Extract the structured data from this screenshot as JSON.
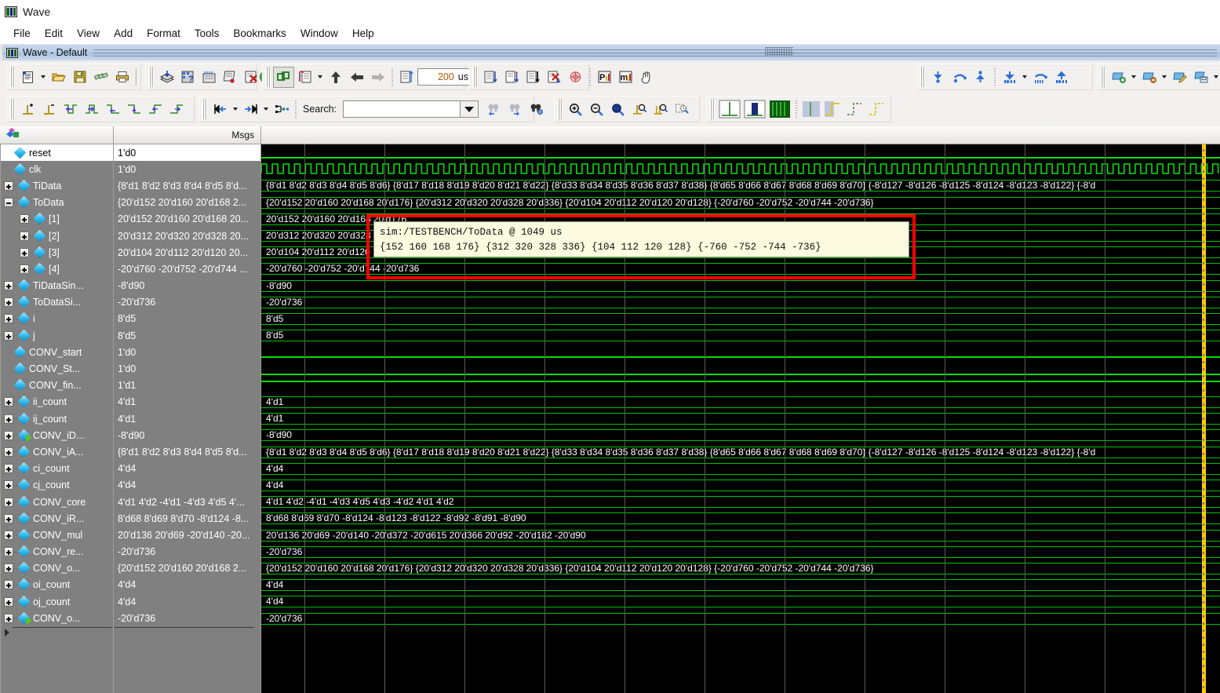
{
  "window": {
    "title": "Wave",
    "icon": "wave-window-icon"
  },
  "menubar": {
    "items": [
      "File",
      "Edit",
      "View",
      "Add",
      "Format",
      "Tools",
      "Bookmarks",
      "Window",
      "Help"
    ]
  },
  "doctab": {
    "label": "Wave - Default",
    "icon": "wave-doc-icon"
  },
  "toolbar": {
    "run_length_value": "200",
    "run_length_unit": "us",
    "search_label": "Search:",
    "search_value": "",
    "row1_icons": [
      "new-document-icon",
      "open-folder-icon",
      "save-icon",
      "reload-icon",
      "print-icon",
      "cut-icon",
      "copy-icon",
      "paste-icon",
      "undo-icon",
      "redo-icon",
      "add-wave-icon",
      "find-icon",
      "properties-icon",
      "compile-icon",
      "simulate-icon",
      "restart-icon",
      "run-icon",
      "stop-icon",
      "group-icon",
      "insert-breakpoint-icon",
      "step-up-icon",
      "step-back-icon",
      "step-forward-icon",
      "run-all-icon",
      "run-length-field",
      "step-icon",
      "step-over-icon",
      "step-out-icon",
      "break-icon",
      "restart-sim-icon",
      "profile-perf-icon",
      "profile-mem-icon",
      "hand-pan-icon",
      "insert-cursor-icon",
      "next-transition-icon",
      "prev-transition-icon",
      "cursor-down-icon",
      "cursor-round-icon",
      "cursor-up-icon",
      "wave-add-icon",
      "wave-remove-icon",
      "wave-edit-icon",
      "wave-save-icon",
      "wave-export-icon"
    ],
    "row2_icons": [
      "add-cursor-icon",
      "delete-cursor-icon",
      "find-prev-transition-icon",
      "find-next-transition-icon",
      "find-prev-falling-icon",
      "find-next-falling-icon",
      "find-prev-rising-icon",
      "find-next-rising-icon",
      "expand-left-icon",
      "collapse-icon",
      "expand-all-icon",
      "search-prev-icon",
      "search-next-icon",
      "search-config-icon",
      "zoom-in-icon",
      "zoom-out-icon",
      "zoom-full-icon",
      "zoom-cursor-icon",
      "zoom-range-icon",
      "zoom-mouse-icon",
      "grid-line-icon",
      "grid-bar-icon",
      "grid-solid-icon",
      "analog-step-icon",
      "analog-interpolated-icon",
      "analog-back-icon",
      "analog-forward-icon"
    ]
  },
  "panes": {
    "names_header_icon": "objects-icon",
    "values_header": "Msgs"
  },
  "signals": [
    {
      "name": "reset",
      "value": "1'd0",
      "indent": 0,
      "expand": "none",
      "selected": true,
      "wave": "low",
      "icon": "signal-diamond"
    },
    {
      "name": "clk",
      "value": "1'd0",
      "indent": 0,
      "expand": "none",
      "selected": false,
      "wave": "clock",
      "icon": "signal-diamond"
    },
    {
      "name": "TiData",
      "value": "{8'd1 8'd2 8'd3 8'd4 8'd5 8'd...",
      "indent": 0,
      "expand": "plus",
      "selected": false,
      "wave": "bus",
      "icon": "signal-diamond",
      "wave_text": "{8'd1 8'd2 8'd3 8'd4 8'd5 8'd6} {8'd17 8'd18 8'd19 8'd20 8'd21 8'd22} {8'd33 8'd34 8'd35 8'd36 8'd37 8'd38} {8'd65 8'd66 8'd67 8'd68 8'd69 8'd70} {-8'd127 -8'd126 -8'd125 -8'd124 -8'd123 -8'd122} {-8'd"
    },
    {
      "name": "ToData",
      "value": "{20'd152 20'd160 20'd168 2...",
      "indent": 0,
      "expand": "minus",
      "selected": false,
      "wave": "bus",
      "icon": "signal-diamond",
      "wave_text": "{20'd152 20'd160 20'd168 20'd176} {20'd312 20'd320 20'd328 20'd336} {20'd104 20'd112 20'd120 20'd128} {-20'd760 -20'd752 -20'd744 -20'd736}"
    },
    {
      "name": "[1]",
      "value": "20'd152 20'd160 20'd168 20...",
      "indent": 1,
      "expand": "plus",
      "selected": false,
      "wave": "bus",
      "icon": "signal-diamond",
      "wave_text": "20'd152 20'd160 20'd168 20'd176"
    },
    {
      "name": "[2]",
      "value": "20'd312 20'd320 20'd328 20...",
      "indent": 1,
      "expand": "plus",
      "selected": false,
      "wave": "bus",
      "icon": "signal-diamond",
      "wave_text": "20'd312 20'd320 20'd328 20'd336"
    },
    {
      "name": "[3]",
      "value": "20'd104 20'd112 20'd120 20...",
      "indent": 1,
      "expand": "plus",
      "selected": false,
      "wave": "bus",
      "icon": "signal-diamond",
      "wave_text": "20'd104 20'd112 20'd120 20'd128"
    },
    {
      "name": "[4]",
      "value": "-20'd760 -20'd752 -20'd744 ...",
      "indent": 1,
      "expand": "plus",
      "selected": false,
      "wave": "bus",
      "icon": "signal-diamond",
      "wave_text": "-20'd760 -20'd752 -20'd744 -20'd736"
    },
    {
      "name": "TiDataSin...",
      "value": "-8'd90",
      "indent": 0,
      "expand": "plus",
      "selected": false,
      "wave": "bus",
      "icon": "signal-diamond",
      "wave_text": "-8'd90"
    },
    {
      "name": "ToDataSi...",
      "value": "-20'd736",
      "indent": 0,
      "expand": "plus",
      "selected": false,
      "wave": "bus",
      "icon": "signal-diamond",
      "wave_text": "-20'd736"
    },
    {
      "name": "i",
      "value": "8'd5",
      "indent": 0,
      "expand": "plus",
      "selected": false,
      "wave": "bus",
      "icon": "signal-diamond",
      "wave_text": "8'd5"
    },
    {
      "name": "j",
      "value": "8'd5",
      "indent": 0,
      "expand": "plus",
      "selected": false,
      "wave": "bus",
      "icon": "signal-diamond",
      "wave_text": "8'd5"
    },
    {
      "name": "CONV_start",
      "value": "1'd0",
      "indent": 0,
      "expand": "none",
      "selected": false,
      "wave": "low",
      "icon": "signal-diamond"
    },
    {
      "name": "CONV_St...",
      "value": "1'd0",
      "indent": 0,
      "expand": "none",
      "selected": false,
      "wave": "low",
      "icon": "signal-diamond"
    },
    {
      "name": "CONV_fin...",
      "value": "1'd1",
      "indent": 0,
      "expand": "none",
      "selected": false,
      "wave": "high",
      "icon": "signal-diamond"
    },
    {
      "name": "ii_count",
      "value": "4'd1",
      "indent": 0,
      "expand": "plus",
      "selected": false,
      "wave": "bus",
      "icon": "signal-diamond",
      "wave_text": "4'd1"
    },
    {
      "name": "ij_count",
      "value": "4'd1",
      "indent": 0,
      "expand": "plus",
      "selected": false,
      "wave": "bus",
      "icon": "signal-diamond",
      "wave_text": "4'd1"
    },
    {
      "name": "CONV_iD...",
      "value": "-8'd90",
      "indent": 0,
      "expand": "plus",
      "selected": false,
      "wave": "bus",
      "icon": "signal-diamond-output",
      "wave_text": "-8'd90"
    },
    {
      "name": "CONV_iA...",
      "value": "{8'd1 8'd2 8'd3 8'd4 8'd5 8'd...",
      "indent": 0,
      "expand": "plus",
      "selected": false,
      "wave": "bus",
      "icon": "signal-diamond",
      "wave_text": "{8'd1 8'd2 8'd3 8'd4 8'd5 8'd6} {8'd17 8'd18 8'd19 8'd20 8'd21 8'd22} {8'd33 8'd34 8'd35 8'd36 8'd37 8'd38} {8'd65 8'd66 8'd67 8'd68 8'd69 8'd70} {-8'd127 -8'd126 -8'd125 -8'd124 -8'd123 -8'd122} {-8'd"
    },
    {
      "name": "ci_count",
      "value": "4'd4",
      "indent": 0,
      "expand": "plus",
      "selected": false,
      "wave": "bus",
      "icon": "signal-diamond",
      "wave_text": "4'd4"
    },
    {
      "name": "cj_count",
      "value": "4'd4",
      "indent": 0,
      "expand": "plus",
      "selected": false,
      "wave": "bus",
      "icon": "signal-diamond",
      "wave_text": "4'd4"
    },
    {
      "name": "CONV_core",
      "value": "4'd1 4'd2 -4'd1 -4'd3 4'd5 4'...",
      "indent": 0,
      "expand": "plus",
      "selected": false,
      "wave": "bus",
      "icon": "signal-diamond",
      "wave_text": "4'd1 4'd2 -4'd1 -4'd3 4'd5 4'd3 -4'd2 4'd1 4'd2"
    },
    {
      "name": "CONV_iR...",
      "value": "8'd68 8'd69 8'd70 -8'd124 -8...",
      "indent": 0,
      "expand": "plus",
      "selected": false,
      "wave": "bus",
      "icon": "signal-diamond",
      "wave_text": "8'd68 8'd69 8'd70 -8'd124 -8'd123 -8'd122 -8'd92 -8'd91 -8'd90"
    },
    {
      "name": "CONV_mul",
      "value": "20'd136 20'd69 -20'd140 -20...",
      "indent": 0,
      "expand": "plus",
      "selected": false,
      "wave": "bus",
      "icon": "signal-diamond",
      "wave_text": "20'd136 20'd69 -20'd140 -20'd372 -20'd615 20'd366 20'd92 -20'd182 -20'd90"
    },
    {
      "name": "CONV_re...",
      "value": "-20'd736",
      "indent": 0,
      "expand": "plus",
      "selected": false,
      "wave": "bus",
      "icon": "signal-diamond",
      "wave_text": "-20'd736"
    },
    {
      "name": "CONV_o...",
      "value": "{20'd152 20'd160 20'd168 2...",
      "indent": 0,
      "expand": "plus",
      "selected": false,
      "wave": "bus",
      "icon": "signal-diamond",
      "wave_text": "{20'd152 20'd160 20'd168 20'd176} {20'd312 20'd320 20'd328 20'd336} {20'd104 20'd112 20'd120 20'd128} {-20'd760 -20'd752 -20'd744 -20'd736}"
    },
    {
      "name": "oi_count",
      "value": "4'd4",
      "indent": 0,
      "expand": "plus",
      "selected": false,
      "wave": "bus",
      "icon": "signal-diamond",
      "wave_text": "4'd4"
    },
    {
      "name": "oj_count",
      "value": "4'd4",
      "indent": 0,
      "expand": "plus",
      "selected": false,
      "wave": "bus",
      "icon": "signal-diamond",
      "wave_text": "4'd4"
    },
    {
      "name": "CONV_o...",
      "value": "-20'd736",
      "indent": 0,
      "expand": "plus",
      "selected": false,
      "wave": "bus",
      "icon": "signal-diamond-output",
      "wave_text": "-20'd736"
    }
  ],
  "tooltip": {
    "line1": "sim:/TESTBENCH/ToData @ 1049 us",
    "line2": "{152 160 168 176} {312 320 328 336} {104 112 120 128} {-760 -752 -744 -736}",
    "highlight_color": "#ff0000",
    "background_color": "#fdfbdf"
  },
  "colors": {
    "wave_background": "#000000",
    "wave_green": "#00e000",
    "cursor_yellow": "#ffcc00",
    "pane_gray": "#808080"
  }
}
